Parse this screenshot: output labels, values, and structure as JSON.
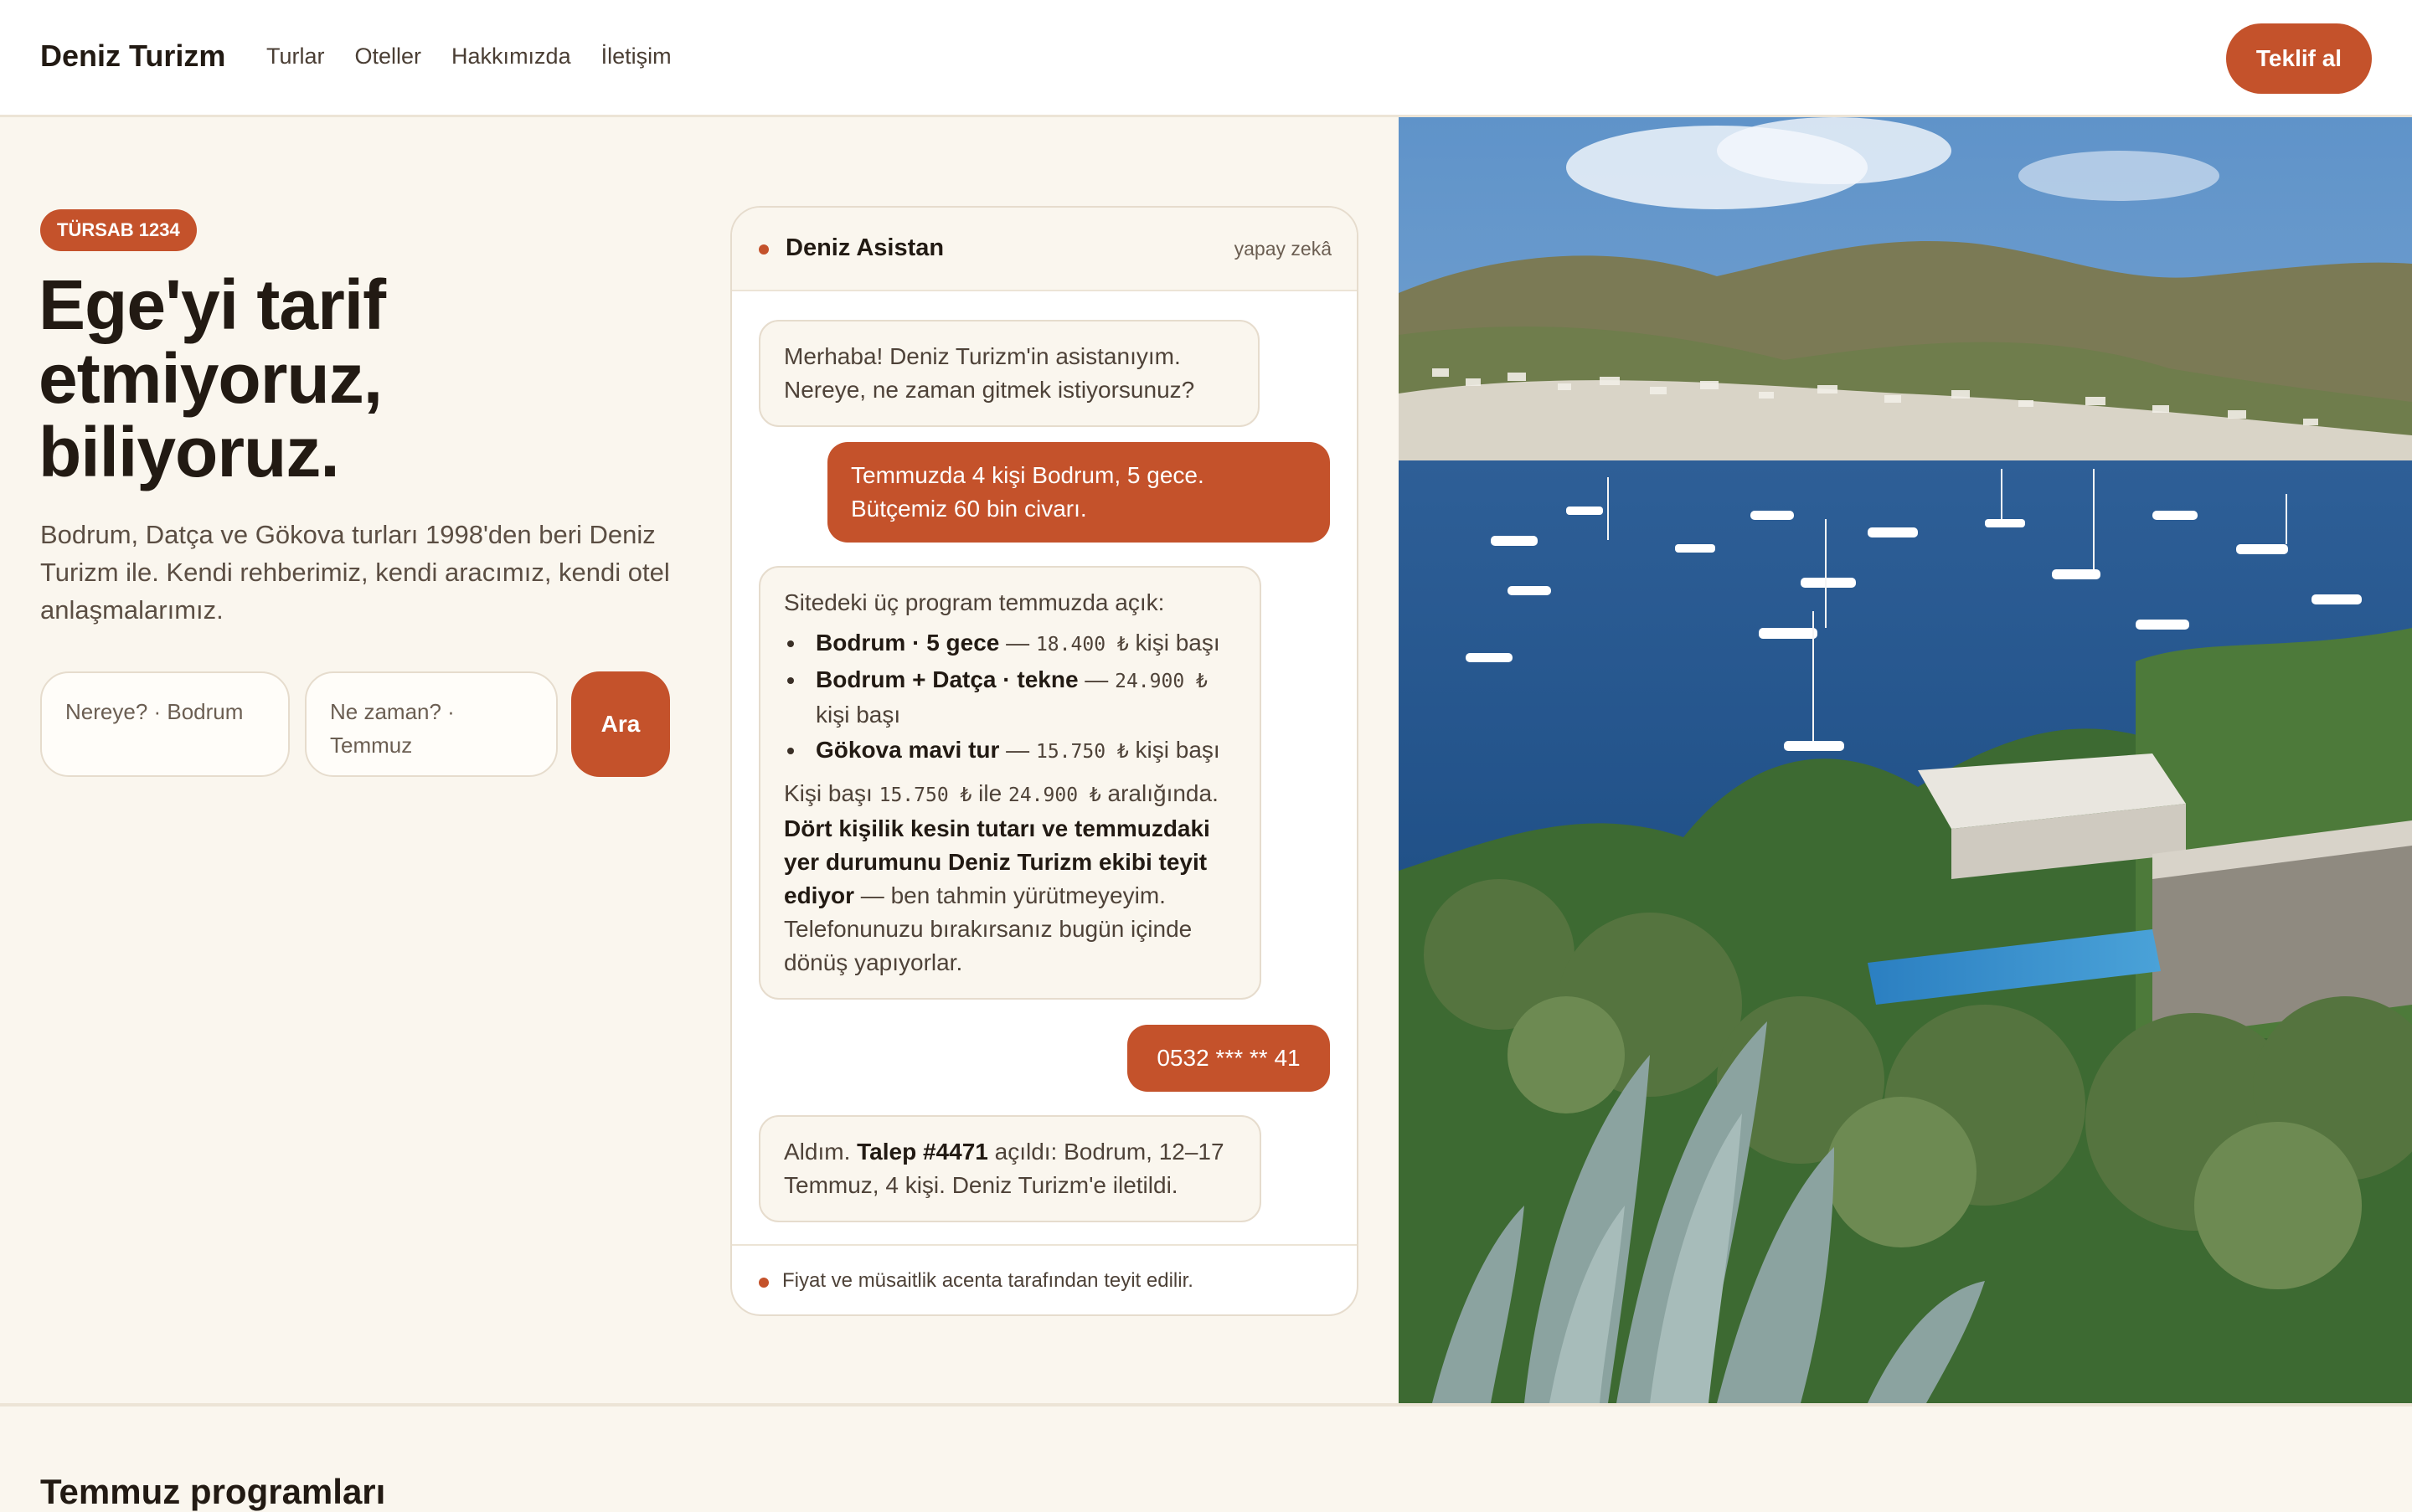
{
  "header": {
    "brand": "Deniz Turizm",
    "nav": [
      "Turlar",
      "Oteller",
      "Hakkımızda",
      "İletişim"
    ],
    "cta_label": "Teklif al"
  },
  "hero": {
    "badge": "TÜRSAB 1234",
    "headline_lines": [
      "Ege'yi tarif",
      "etmiyoruz,",
      "biliyoruz."
    ],
    "lead": "Bodrum, Datça ve Gökova turları 1998'den beri Deniz Turizm ile. Kendi rehberimiz, kendi aracımız, kendi otel anlaşmalarımız.",
    "search": {
      "where": "Nereye? · Bodrum",
      "when": "Ne zaman? · Temmuz",
      "button": "Ara"
    }
  },
  "chat": {
    "title": "Deniz Asistan",
    "subtitle": "yapay zekâ",
    "messages": {
      "bot1": "Merhaba! Deniz Turizm'in asistanıyım. Nereye, ne zaman gitmek istiyorsunuz?",
      "user1": "Temmuzda 4 kişi Bodrum, 5 gece. Bütçemiz 60 bin civarı.",
      "bot2_intro": "Sitedeki üç program temmuzda açık:",
      "programs": [
        {
          "name": "Bodrum · 5 gece",
          "sep": " — ",
          "price": "18.400 ₺",
          "unit": " kişi başı"
        },
        {
          "name": "Bodrum + Datça · tekne",
          "sep": " — ",
          "price": "24.900 ₺",
          "unit": " kişi başı"
        },
        {
          "name": "Gökova mavi tur",
          "sep": " — ",
          "price": "15.750 ₺",
          "unit": " kişi başı"
        }
      ],
      "range_prefix": "Kişi başı ",
      "range_min": "15.750 ₺",
      "range_mid": " ile ",
      "range_max": "24.900 ₺",
      "range_suffix": " aralığında.",
      "confirm_bold": "Dört kişilik kesin tutarı ve temmuzdaki yer durumunu Deniz Turizm ekibi teyit ediyor",
      "confirm_rest": " — ben tahmin yürütmeyeyim. Telefonunuzu bırakırsanız bugün içinde dönüş yapıyorlar.",
      "user2": "0532 *** ** 41",
      "bot3_pre": "Aldım. ",
      "bot3_bold": "Talep #4471",
      "bot3_rest": " açıldı: Bodrum, 12–17 Temmuz, 4 kişi. Deniz Turizm'e iletildi."
    },
    "footer": "Fiyat ve müsaitlik acenta tarafından teyit edilir."
  },
  "section": {
    "title": "Temmuz programları"
  },
  "colors": {
    "accent": "#c4522b",
    "background": "#faf6ee",
    "text": "#221a13"
  }
}
